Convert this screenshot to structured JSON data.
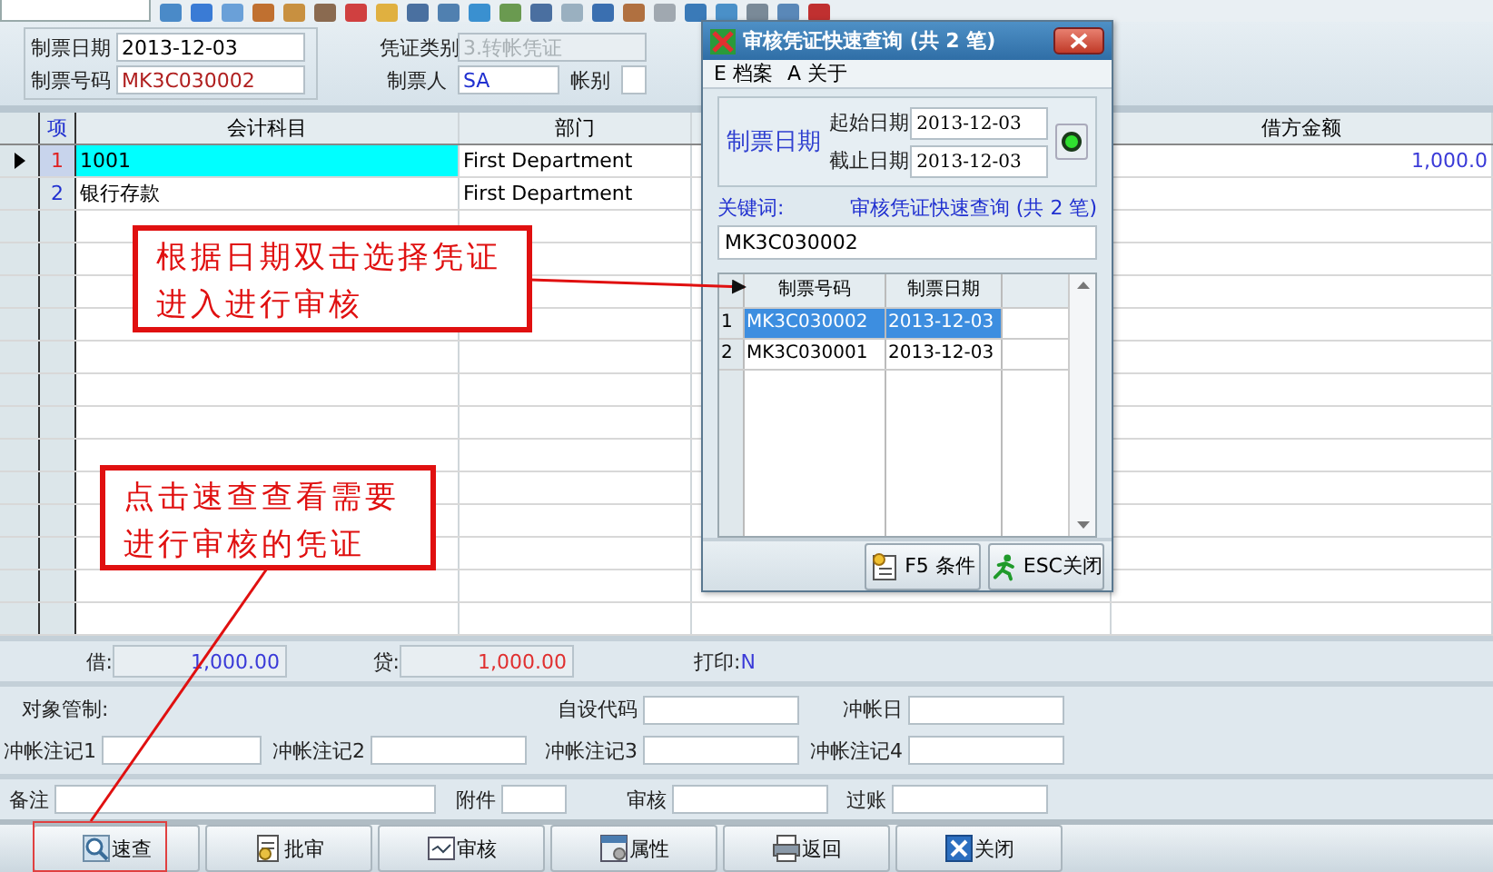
{
  "voucher_header": {
    "date_label": "制票日期",
    "date": "2013-12-03",
    "number_label": "制票号码",
    "number": "MK3C030002",
    "type_label": "凭证类别",
    "type": "3.转帐凭证",
    "type_disabled": true,
    "maker_label": "制票人",
    "maker": "SA",
    "book_label": "帐别"
  },
  "entries": {
    "columns": [
      "项",
      "会计科目",
      "部门",
      "借方金额"
    ],
    "rows": [
      {
        "index": "1",
        "account": "1001",
        "department": "First Department",
        "debit": "1,000.0",
        "selected": true
      },
      {
        "index": "2",
        "account": "银行存款",
        "department": "First Department",
        "debit": "",
        "selected": false
      }
    ]
  },
  "totals": {
    "debit_label": "借:",
    "debit": "1,000.00",
    "credit_label": "贷:",
    "credit": "1,000.00",
    "print_label": "打印:",
    "print": "N"
  },
  "details": {
    "object_label": "对象管制:",
    "row1": [
      {
        "label": "自设代码"
      },
      {
        "label": "冲帐日"
      }
    ],
    "row2": [
      {
        "label": "冲帐注记1"
      },
      {
        "label": "冲帐注记2"
      },
      {
        "label": "冲帐注记3"
      },
      {
        "label": "冲帐注记4"
      }
    ]
  },
  "footer_fields": [
    {
      "label": "备注"
    },
    {
      "label": "附件"
    },
    {
      "label": "审核"
    },
    {
      "label": "过账"
    }
  ],
  "buttons": [
    {
      "label": "速查",
      "kind": "search"
    },
    {
      "label": "批审",
      "kind": "batch"
    },
    {
      "label": "审核",
      "kind": "audit"
    },
    {
      "label": "属性",
      "kind": "properties"
    },
    {
      "label": "返回",
      "kind": "back"
    },
    {
      "label": "关闭",
      "kind": "close"
    }
  ],
  "dialog": {
    "title": "审核凭证快速查询 (共 2 笔)",
    "menu": [
      "E 档案",
      "A 关于"
    ],
    "date_group": "制票日期",
    "start_label": "起始日期",
    "start": "2013-12-03",
    "end_label": "截止日期",
    "end": "2013-12-03",
    "keyword_label": "关键词:",
    "summary": "审核凭证快速查询 (共 2 笔)",
    "keyword": "MK3C030002",
    "columns": [
      "制票号码",
      "制票日期"
    ],
    "rows": [
      {
        "index": "1",
        "number": "MK3C030002",
        "date": "2013-12-03",
        "selected": true
      },
      {
        "index": "2",
        "number": "MK3C030001",
        "date": "2013-12-03",
        "selected": false
      }
    ],
    "buttons": [
      {
        "label": "F5 条件",
        "kind": "condition"
      },
      {
        "label": "ESC关闭",
        "kind": "exit"
      }
    ]
  },
  "annotations": [
    {
      "text": "根据日期双击选择凭证进入进行审核"
    },
    {
      "text": "点击速查查看需要进行审核的凭证"
    }
  ]
}
